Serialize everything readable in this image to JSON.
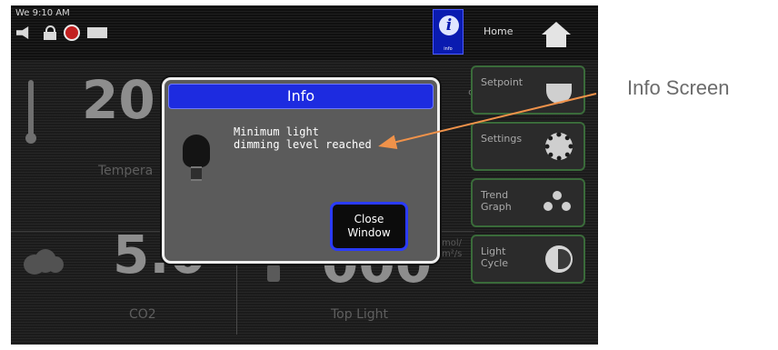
{
  "status": {
    "time": "We 9:10 AM"
  },
  "header": {
    "info_sub_label": "info",
    "home_label": "Home"
  },
  "dashboard": {
    "temperature": {
      "value": "20",
      "label": "Tempera"
    },
    "co2": {
      "value": "5.0",
      "label": "CO2"
    },
    "top_light": {
      "value": "000",
      "label": "Top Light"
    },
    "humidity_unit": "%",
    "side_partial": [
      "mol/",
      "m²/s"
    ]
  },
  "side_menu": [
    {
      "label": "Setpoint",
      "icon": "lamp-icon"
    },
    {
      "label": "Settings",
      "icon": "gear-icon"
    },
    {
      "label": "Trend\nGraph",
      "icon": "trend-graph-icon"
    },
    {
      "label": "Light\nCycle",
      "icon": "light-cycle-icon"
    }
  ],
  "modal": {
    "title": "Info",
    "message_line1": "Minimum light",
    "message_line2": "dimming level reached",
    "close_label_line1": "Close",
    "close_label_line2": "Window"
  },
  "annotation": {
    "label": "Info Screen",
    "color": "#f0924a"
  }
}
